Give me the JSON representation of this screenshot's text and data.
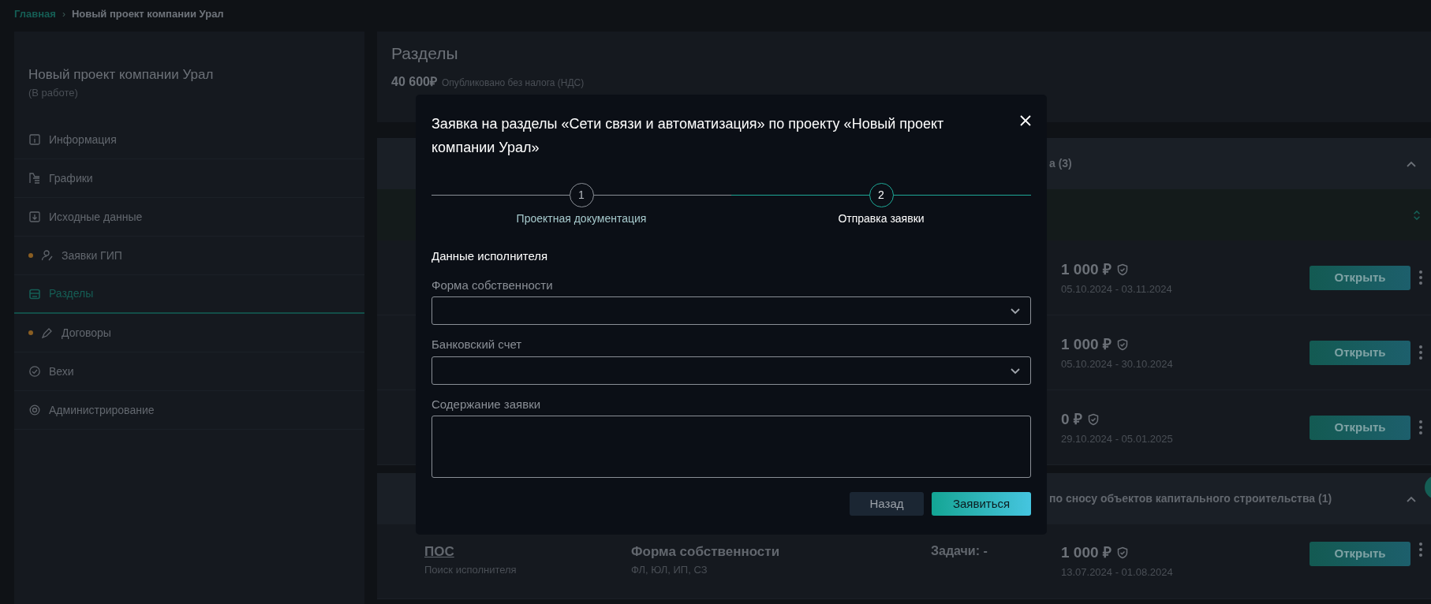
{
  "breadcrumb_separator": "›",
  "breadcrumb": [
    {
      "label": "Главная",
      "kind": "link"
    },
    {
      "label": "Новый проект компании Урал",
      "kind": "current"
    }
  ],
  "sidebar": {
    "title": "Новый проект компании Урал",
    "status": "(В работе)",
    "items": [
      {
        "label": "Информация",
        "dot": false,
        "selected": false
      },
      {
        "label": "Графики",
        "dot": false,
        "selected": false
      },
      {
        "label": "Исходные данные",
        "dot": false,
        "selected": false
      },
      {
        "label": "Заявки ГИП",
        "dot": true,
        "selected": false
      },
      {
        "label": "Разделы",
        "dot": false,
        "selected": true
      },
      {
        "label": "Договоры",
        "dot": true,
        "selected": false
      },
      {
        "label": "Вехи",
        "dot": false,
        "selected": false
      },
      {
        "label": "Администрирование",
        "dot": false,
        "selected": false
      }
    ]
  },
  "main": {
    "title": "Разделы",
    "total": "40 600₽",
    "total_note": "Опубликовано без налога (НДС)",
    "groups": [
      {
        "title": "а (3)",
        "expanded": true,
        "filter_bar": true,
        "rows": [
          {
            "price": "1 000 ₽",
            "dates": "05.10.2024 - 03.11.2024",
            "button": "Открыть"
          },
          {
            "price": "1 000 ₽",
            "dates": "05.10.2024 - 30.10.2024",
            "button": "Открыть"
          },
          {
            "price": "0 ₽",
            "dates": "29.10.2024 - 05.01.2025",
            "button": "Открыть"
          }
        ]
      },
      {
        "title": "по сносу объектов капитального строительства (1)",
        "expanded": true,
        "rows": [
          {
            "name": "ПОС",
            "status": "Поиск исполнителя",
            "form_label": "Форма собственности",
            "form_values": "ФЛ, ЮЛ, ИП, СЗ",
            "tasks": "Задачи: -",
            "price": "1 000 ₽",
            "dates": "13.07.2024 - 01.08.2024",
            "button": "Открыть"
          }
        ]
      }
    ]
  },
  "modal": {
    "title": "Заявка на разделы «Сети связи и автоматизация» по проекту «Новый проект компании Урал»",
    "steps": [
      {
        "number": "1",
        "label": "Проектная документация",
        "selected": false
      },
      {
        "number": "2",
        "label": "Отправка заявки",
        "selected": true
      }
    ],
    "section_title": "Данные исполнителя",
    "fields": [
      {
        "label": "Форма собственности",
        "kind": "select"
      },
      {
        "label": "Банковский счет",
        "kind": "select"
      },
      {
        "label": "Содержание заявки",
        "kind": "textarea"
      }
    ],
    "buttons": [
      {
        "label": "Назад",
        "kind": "secondary"
      },
      {
        "label": "Заявиться",
        "kind": "primary"
      }
    ]
  }
}
